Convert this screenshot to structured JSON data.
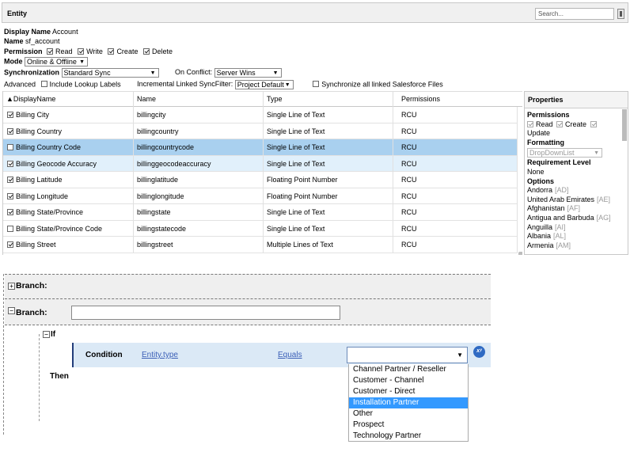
{
  "entity_panel": {
    "title": "Entity",
    "search_placeholder": "Search...",
    "display_name_label": "Display Name",
    "display_name_value": "Account",
    "name_label": "Name",
    "name_value": "sf_account",
    "permission_label": "Permission",
    "permissions": [
      {
        "label": "Read",
        "checked": true
      },
      {
        "label": "Write",
        "checked": true
      },
      {
        "label": "Create",
        "checked": true
      },
      {
        "label": "Delete",
        "checked": true
      }
    ],
    "mode_label": "Mode",
    "mode_value": "Online & Offline",
    "sync_label": "Synchronization",
    "sync_value": "Standard Sync",
    "conflict_label": "On Conflict:",
    "conflict_value": "Server Wins",
    "advanced_label": "Advanced",
    "include_lookup_label": "Include Lookup Labels",
    "incremental_label": "Incremental Linked SyncFilter:",
    "incremental_value": "Project Default",
    "sync_files_label": "Synchronize all linked Salesforce Files"
  },
  "grid": {
    "columns": [
      "DisplayName",
      "Name",
      "Type",
      "Permissions"
    ],
    "rows": [
      {
        "checked": true,
        "display": "Billing City",
        "name": "billingcity",
        "type": "Single Line of Text",
        "perm": "RCU"
      },
      {
        "checked": true,
        "display": "Billing Country",
        "name": "billingcountry",
        "type": "Single Line of Text",
        "perm": "RCU"
      },
      {
        "checked": false,
        "display": "Billing Country Code",
        "name": "billingcountrycode",
        "type": "Single Line of Text",
        "perm": "RCU"
      },
      {
        "checked": true,
        "display": "Billing Geocode Accuracy",
        "name": "billinggeocodeaccuracy",
        "type": "Single Line of Text",
        "perm": "RCU"
      },
      {
        "checked": true,
        "display": "Billing Latitude",
        "name": "billinglatitude",
        "type": "Floating Point Number",
        "perm": "RCU"
      },
      {
        "checked": true,
        "display": "Billing Longitude",
        "name": "billinglongitude",
        "type": "Floating Point Number",
        "perm": "RCU"
      },
      {
        "checked": true,
        "display": "Billing State/Province",
        "name": "billingstate",
        "type": "Single Line of Text",
        "perm": "RCU"
      },
      {
        "checked": false,
        "display": "Billing State/Province Code",
        "name": "billingstatecode",
        "type": "Single Line of Text",
        "perm": "RCU"
      },
      {
        "checked": true,
        "display": "Billing Street",
        "name": "billingstreet",
        "type": "Multiple Lines of Text",
        "perm": "RCU"
      }
    ]
  },
  "properties": {
    "title": "Properties",
    "permissions_heading": "Permissions",
    "perm_read": "Read",
    "perm_create": "Create",
    "perm_update": "Update",
    "formatting_heading": "Formatting",
    "formatting_value": "DropDownList",
    "requirement_heading": "Requirement Level",
    "requirement_value": "None",
    "options_heading": "Options",
    "options": [
      {
        "name": "Andorra",
        "code": "[AD]"
      },
      {
        "name": "United Arab Emirates",
        "code": "[AE]"
      },
      {
        "name": "Afghanistan",
        "code": "[AF]"
      },
      {
        "name": "Antigua and Barbuda",
        "code": "[AG]"
      },
      {
        "name": "Anguilla",
        "code": "[AI]"
      },
      {
        "name": "Albania",
        "code": "[AL]"
      },
      {
        "name": "Armenia",
        "code": "[AM]"
      }
    ]
  },
  "workflow": {
    "branch1_label": "Branch:",
    "branch2_label": "Branch:",
    "if_label": "If",
    "condition_label": "Condition",
    "field_link": "Entity.type",
    "operator_link": "Equals",
    "then_label": "Then",
    "expr_button": "xʸ",
    "dropdown_options": [
      "Channel Partner / Reseller",
      "Customer - Channel",
      "Customer - Direct",
      "Installation Partner",
      "Other",
      "Prospect",
      "Technology Partner"
    ],
    "highlighted_option": 3
  }
}
